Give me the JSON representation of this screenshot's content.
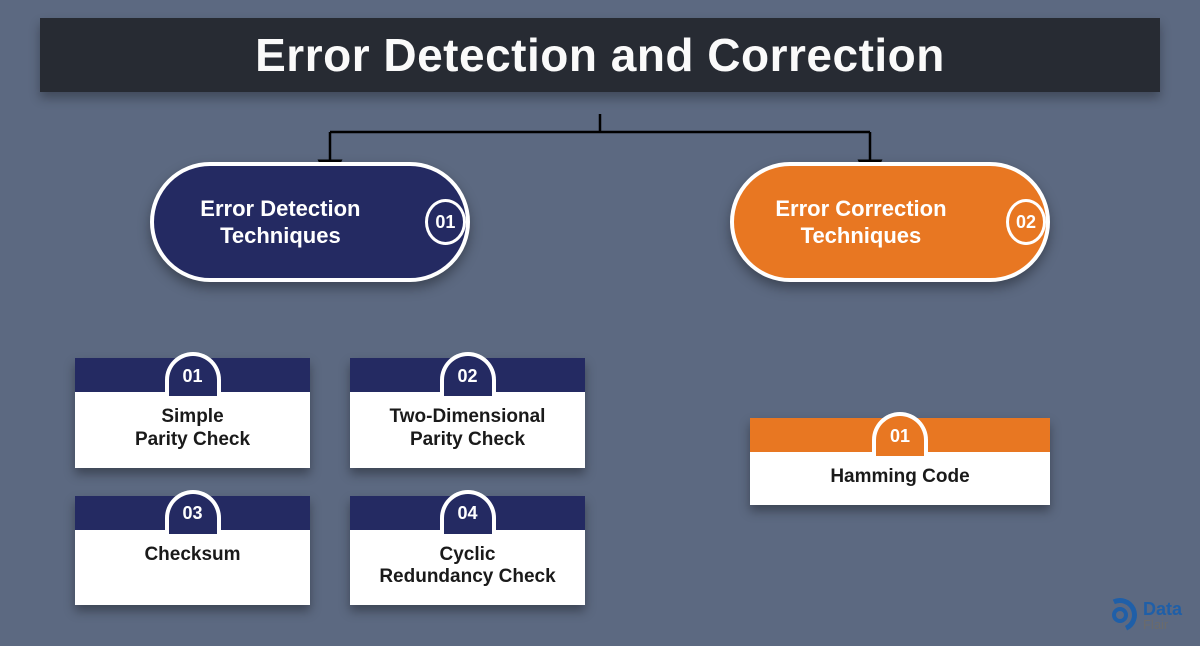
{
  "title": "Error Detection and Correction",
  "branches": [
    {
      "label": "Error\nDetection\nTechniques",
      "num": "01",
      "color": "navy"
    },
    {
      "label": "Error\nCorrection\nTechniques",
      "num": "02",
      "color": "orange"
    }
  ],
  "detection_cards": [
    {
      "num": "01",
      "label": "Simple\nParity Check"
    },
    {
      "num": "02",
      "label": "Two-Dimensional\nParity Check"
    },
    {
      "num": "03",
      "label": "Checksum"
    },
    {
      "num": "04",
      "label": "Cyclic\nRedundancy Check"
    }
  ],
  "correction_cards": [
    {
      "num": "01",
      "label": "Hamming Code"
    }
  ],
  "logo": {
    "line1": "Data",
    "line2": "Flair"
  }
}
